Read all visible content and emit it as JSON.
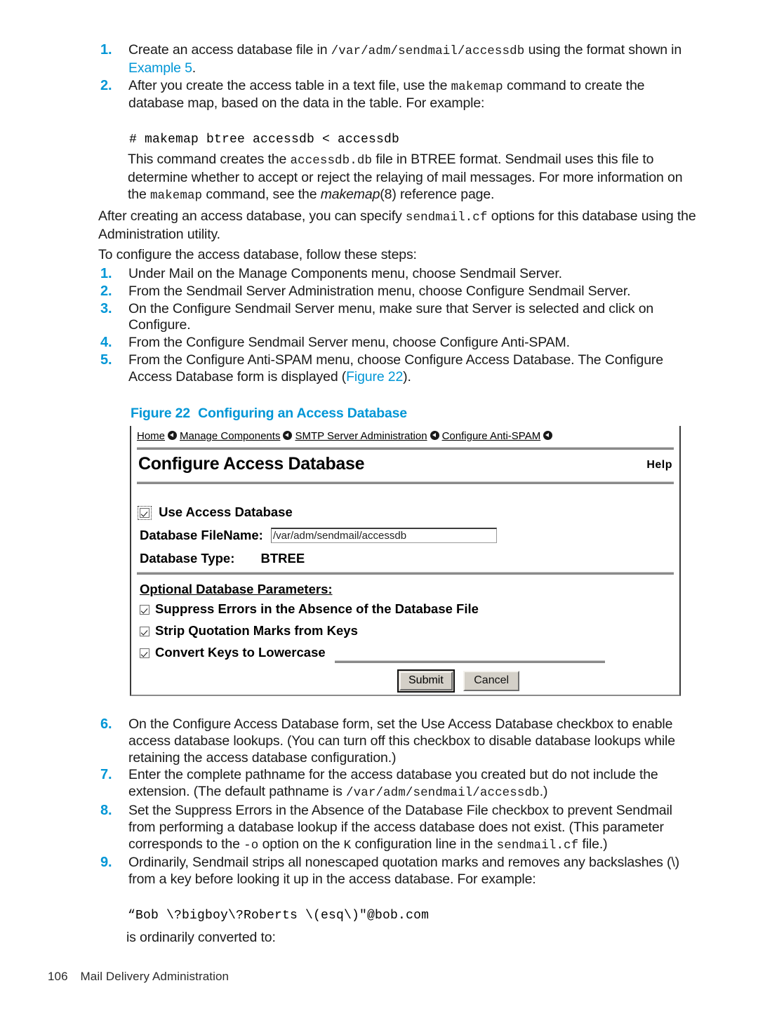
{
  "document": {
    "footer_page_number": "106",
    "footer_title": "Mail Delivery Administration"
  },
  "intro_steps": [
    {
      "num": "1.",
      "parts": [
        {
          "t": "Create an access database file in ",
          "s": "plain"
        },
        {
          "t": "/var/adm/sendmail/accessdb",
          "s": "mono"
        },
        {
          "t": " using the format shown in ",
          "s": "plain"
        },
        {
          "t": "Example 5",
          "s": "link"
        },
        {
          "t": ".",
          "s": "plain"
        }
      ]
    },
    {
      "num": "2.",
      "parts": [
        {
          "t": "After you create the access table in a text file, use the ",
          "s": "plain"
        },
        {
          "t": "makemap",
          "s": "mono"
        },
        {
          "t": " command to create the database map, based on the data in the table. For example:",
          "s": "plain"
        }
      ]
    }
  ],
  "code_makemap": "# makemap btree accessdb < accessdb",
  "paragraph_after_code": [
    {
      "t": "This command creates the ",
      "s": "plain"
    },
    {
      "t": "accessdb.db",
      "s": "mono"
    },
    {
      "t": " file in BTREE format. Sendmail uses this file to determine whether to accept or reject the relaying of mail messages. For more information on the ",
      "s": "plain"
    },
    {
      "t": "makemap",
      "s": "mono"
    },
    {
      "t": " command, see the ",
      "s": "plain"
    },
    {
      "t": "makemap",
      "s": "italic"
    },
    {
      "t": "(8) reference page.",
      "s": "plain"
    }
  ],
  "paragraph_admin_utility": [
    {
      "t": "After creating an access database, you can specify ",
      "s": "plain"
    },
    {
      "t": "sendmail.cf",
      "s": "mono"
    },
    {
      "t": " options for this database using the Administration utility.",
      "s": "plain"
    }
  ],
  "steps_lead_in": "To configure the access database, follow these steps:",
  "config_steps": [
    {
      "num": "1.",
      "parts": [
        {
          "t": "Under Mail on the Manage Components menu, choose Sendmail Server.",
          "s": "plain"
        }
      ]
    },
    {
      "num": "2.",
      "parts": [
        {
          "t": "From the Sendmail Server Administration menu, choose Configure Sendmail Server.",
          "s": "plain"
        }
      ]
    },
    {
      "num": "3.",
      "parts": [
        {
          "t": "On the Configure Sendmail Server menu, make sure that Server is selected and click on Configure.",
          "s": "plain"
        }
      ]
    },
    {
      "num": "4.",
      "parts": [
        {
          "t": "From the Configure Sendmail Server menu, choose Configure Anti-SPAM.",
          "s": "plain"
        }
      ]
    },
    {
      "num": "5.",
      "parts": [
        {
          "t": "From the Configure Anti-SPAM menu, choose Configure Access Database. The Configure Access Database form is displayed (",
          "s": "plain"
        },
        {
          "t": "Figure 22",
          "s": "link"
        },
        {
          "t": ").",
          "s": "plain"
        }
      ]
    }
  ],
  "figure": {
    "caption_label": "Figure 22",
    "caption_text": "Configuring an Access Database",
    "breadcrumb": [
      {
        "label": "Home"
      },
      {
        "label": "Manage Components"
      },
      {
        "label": "SMTP Server Administration"
      },
      {
        "label": "Configure Anti-SPAM"
      }
    ],
    "breadcrumb_separator_icon": "circle-left-arrow-icon",
    "form_title": "Configure Access Database",
    "help_label": "Help",
    "use_access_database": {
      "label": "Use Access Database",
      "checked": true
    },
    "database_filename": {
      "label": "Database FileName:",
      "value": "/var/adm/sendmail/accessdb"
    },
    "database_type": {
      "label": "Database Type:",
      "value": "BTREE"
    },
    "optional_params_label": "Optional Database Parameters:",
    "optional_params": [
      {
        "label": "Suppress Errors in the Absence of the Database File",
        "checked": true
      },
      {
        "label": "Strip Quotation Marks from Keys",
        "checked": true
      },
      {
        "label": "Convert Keys to Lowercase",
        "checked": true
      }
    ],
    "submit_label": "Submit",
    "cancel_label": "Cancel"
  },
  "post_steps": [
    {
      "num": "6.",
      "parts": [
        {
          "t": "On the Configure Access Database form, set the Use Access Database checkbox to enable access database lookups. (You can turn off this checkbox to disable database lookups while retaining the access database configuration.)",
          "s": "plain"
        }
      ]
    },
    {
      "num": "7.",
      "parts": [
        {
          "t": "Enter the complete pathname for the access database you created but do not include the extension. (The default pathname is ",
          "s": "plain"
        },
        {
          "t": "/var/adm/sendmail/accessdb",
          "s": "mono"
        },
        {
          "t": ".)",
          "s": "plain"
        }
      ]
    },
    {
      "num": "8.",
      "parts": [
        {
          "t": "Set the Suppress Errors in the Absence of the Database File checkbox to prevent Sendmail from performing a database lookup if the access database does not exist. (This parameter corresponds to the ",
          "s": "plain"
        },
        {
          "t": "-o",
          "s": "mono"
        },
        {
          "t": " option on the ",
          "s": "plain"
        },
        {
          "t": "K",
          "s": "mono"
        },
        {
          "t": " configuration line in the ",
          "s": "plain"
        },
        {
          "t": "sendmail.cf",
          "s": "mono"
        },
        {
          "t": " file.)",
          "s": "plain"
        }
      ]
    },
    {
      "num": "9.",
      "parts": [
        {
          "t": "Ordinarily, Sendmail strips all nonescaped quotation marks and removes any backslashes (\\) from a key before looking it up in the access database. For example:",
          "s": "plain"
        }
      ]
    }
  ],
  "code_example_key": "“Bob \\?bigboy\\?Roberts \\(esq\\)\"@bob.com",
  "closing_text": "is ordinarily converted to:",
  "colors": {
    "accent_blue": "#0096d6",
    "body_text": "#1a1a1a",
    "figure_border": "#3a3a3a",
    "button_face": "#d4d0c8"
  }
}
